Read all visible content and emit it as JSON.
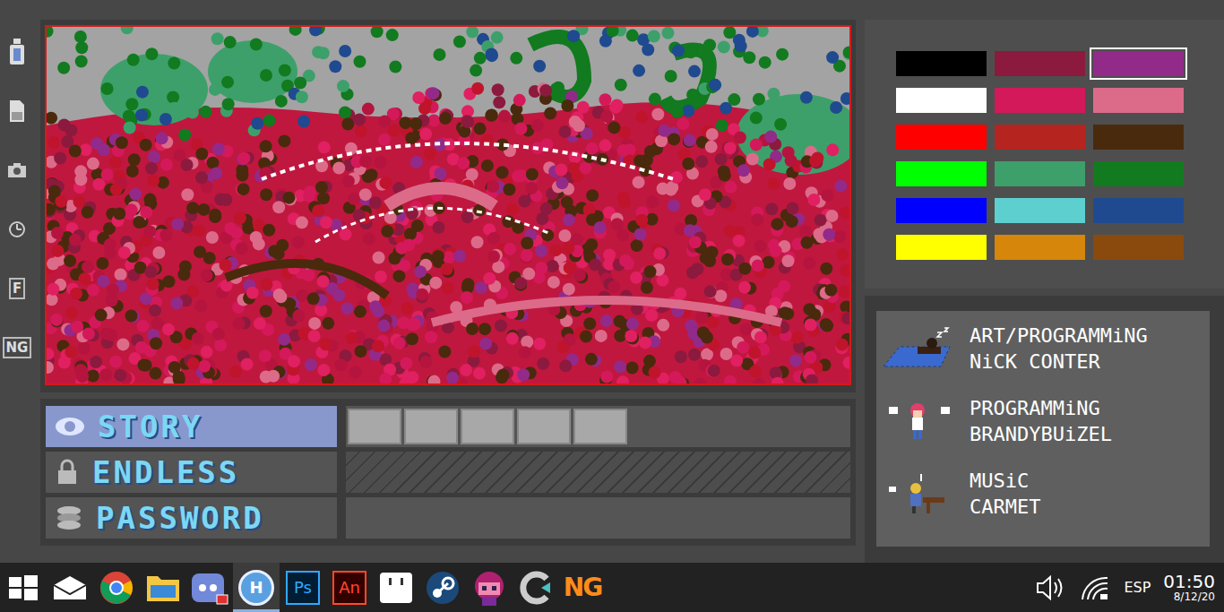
{
  "toolbar": [
    {
      "kind": "ink"
    },
    {
      "kind": "page"
    },
    {
      "kind": "camera"
    },
    {
      "kind": "clock"
    },
    {
      "kind": "text",
      "glyph": "F"
    },
    {
      "kind": "text",
      "glyph": "NG"
    }
  ],
  "palette": {
    "swatches": [
      {
        "color": "#000000",
        "selected": false
      },
      {
        "color": "#8b1a3e",
        "selected": false
      },
      {
        "color": "#922a8a",
        "selected": true
      },
      {
        "color": "#ffffff",
        "selected": false
      },
      {
        "color": "#d4195a",
        "selected": false
      },
      {
        "color": "#dc6b8a",
        "selected": false
      },
      {
        "color": "#ff0000",
        "selected": false
      },
      {
        "color": "#b5241f",
        "selected": false
      },
      {
        "color": "#4a2a0c",
        "selected": false
      },
      {
        "color": "#00ff00",
        "selected": false
      },
      {
        "color": "#3da06a",
        "selected": false
      },
      {
        "color": "#127a1f",
        "selected": false
      },
      {
        "color": "#0000ff",
        "selected": false
      },
      {
        "color": "#5ecfcf",
        "selected": false
      },
      {
        "color": "#1f4a8f",
        "selected": false
      },
      {
        "color": "#ffff00",
        "selected": false
      },
      {
        "color": "#d6860a",
        "selected": false
      },
      {
        "color": "#8a4a0e",
        "selected": false
      }
    ]
  },
  "menu": [
    {
      "label": "STORY",
      "icon": "eye",
      "selected": true,
      "locked": false,
      "kind": "slots",
      "slots": [
        true,
        true,
        true,
        true,
        true
      ]
    },
    {
      "label": "ENDLESS",
      "icon": "lock",
      "selected": false,
      "locked": true,
      "kind": "locked"
    },
    {
      "label": "PASSWORD",
      "icon": "stack",
      "selected": false,
      "locked": false,
      "kind": "field",
      "value": ""
    }
  ],
  "credits": [
    {
      "role": "ART/PROGRAMMiNG",
      "name": "NiCK CONTER",
      "avatar": "sleeper"
    },
    {
      "role": "PROGRAMMiNG",
      "name": "BRANDYBUiZEL",
      "avatar": "girl"
    },
    {
      "role": "MUSiC",
      "name": "CARMET",
      "avatar": "pianist"
    }
  ],
  "taskbar": {
    "apps": [
      {
        "kind": "start",
        "selected": false
      },
      {
        "kind": "mail",
        "selected": false
      },
      {
        "kind": "chrome",
        "selected": false
      },
      {
        "kind": "folder",
        "selected": false
      },
      {
        "kind": "discord",
        "selected": false
      },
      {
        "kind": "hex",
        "glyph": "H",
        "selected": true
      },
      {
        "kind": "ps",
        "glyph": "Ps",
        "selected": false
      },
      {
        "kind": "an",
        "glyph": "An",
        "selected": false
      },
      {
        "kind": "box",
        "selected": false
      },
      {
        "kind": "steam",
        "selected": false
      },
      {
        "kind": "character",
        "selected": false
      },
      {
        "kind": "swirl",
        "selected": false
      },
      {
        "kind": "ng",
        "glyph": "NG",
        "selected": false
      }
    ],
    "tray": {
      "language": "ESP",
      "time": "01:50",
      "date": "8/12/20"
    }
  }
}
